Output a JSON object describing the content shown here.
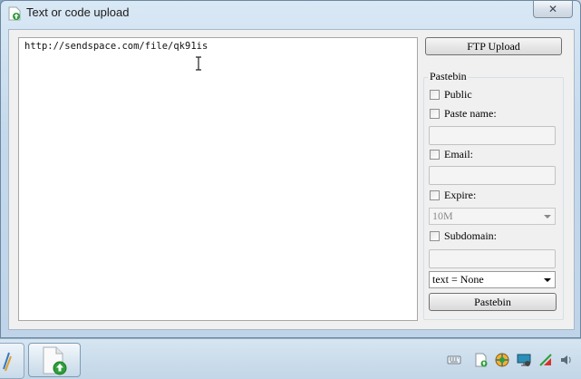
{
  "window": {
    "title": "Text or code upload",
    "close_glyph": "✕"
  },
  "editor": {
    "text": "http://sendspace.com/file/qk91is"
  },
  "buttons": {
    "ftp_upload": "FTP Upload",
    "pastebin": "Pastebin"
  },
  "pastebin_group": {
    "label": "Pastebin",
    "public_label": "Public",
    "paste_name_label": "Paste name:",
    "email_label": "Email:",
    "expire_label": "Expire:",
    "expire_value": "10M",
    "subdomain_label": "Subdomain:",
    "format_value": "text = None"
  },
  "taskbar": {
    "tray_icons": [
      "keyboard-icon",
      "document-upload-icon",
      "browser-icon",
      "monitor-icon",
      "network-icon",
      "speaker-icon"
    ]
  },
  "colors": {
    "window_frame": "#c4d9ec",
    "client_bg": "#f0f0f0",
    "upload_arrow": "#2e9e3a"
  }
}
